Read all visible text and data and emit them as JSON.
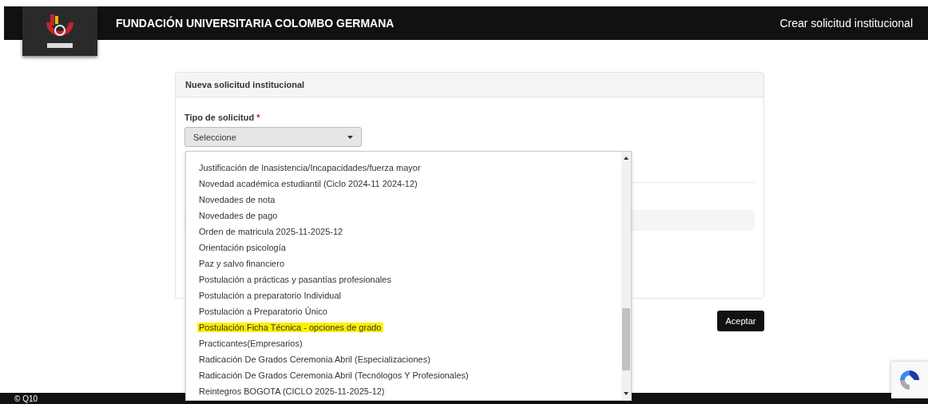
{
  "header": {
    "title": "FUNDACIÓN UNIVERSITARIA COLOMBO GERMANA",
    "action": "Crear solicitud institucional"
  },
  "card": {
    "title": "Nueva solicitud institucional",
    "field_label": "Tipo de solicitud",
    "required_mark": "*",
    "select_value": "Seleccione"
  },
  "dropdown": {
    "options": [
      {
        "label": "Justificación de Inasistencia/Incapacidades/fuerza mayor",
        "highlighted": false
      },
      {
        "label": "Novedad académica estudiantil (Ciclo 2024-11 2024-12)",
        "highlighted": false
      },
      {
        "label": "Novedades de nota",
        "highlighted": false
      },
      {
        "label": "Novedades de pago",
        "highlighted": false
      },
      {
        "label": "Orden de matricula 2025-11-2025-12",
        "highlighted": false
      },
      {
        "label": "Orientación psicología",
        "highlighted": false
      },
      {
        "label": "Paz y salvo financiero",
        "highlighted": false
      },
      {
        "label": "Postulación a prácticas y pasantías profesionales",
        "highlighted": false
      },
      {
        "label": "Postulación a preparatorio Individual",
        "highlighted": false
      },
      {
        "label": "Postulación a Preparatorio Único",
        "highlighted": false
      },
      {
        "label": "Postulación Ficha Técnica - opciones de grado",
        "highlighted": true
      },
      {
        "label": "Practicantes(Empresarios)",
        "highlighted": false
      },
      {
        "label": "Radicación De Grados Ceremonia Abril (Especializaciones)",
        "highlighted": false
      },
      {
        "label": "Radicación De Grados Ceremonia Abril (Tecnólogos Y Profesionales)",
        "highlighted": false
      },
      {
        "label": "Reintegros BOGOTA (CICLO 2025-11-2025-12)",
        "highlighted": false
      }
    ]
  },
  "accept_button": "Aceptar",
  "footer": "© Q10"
}
